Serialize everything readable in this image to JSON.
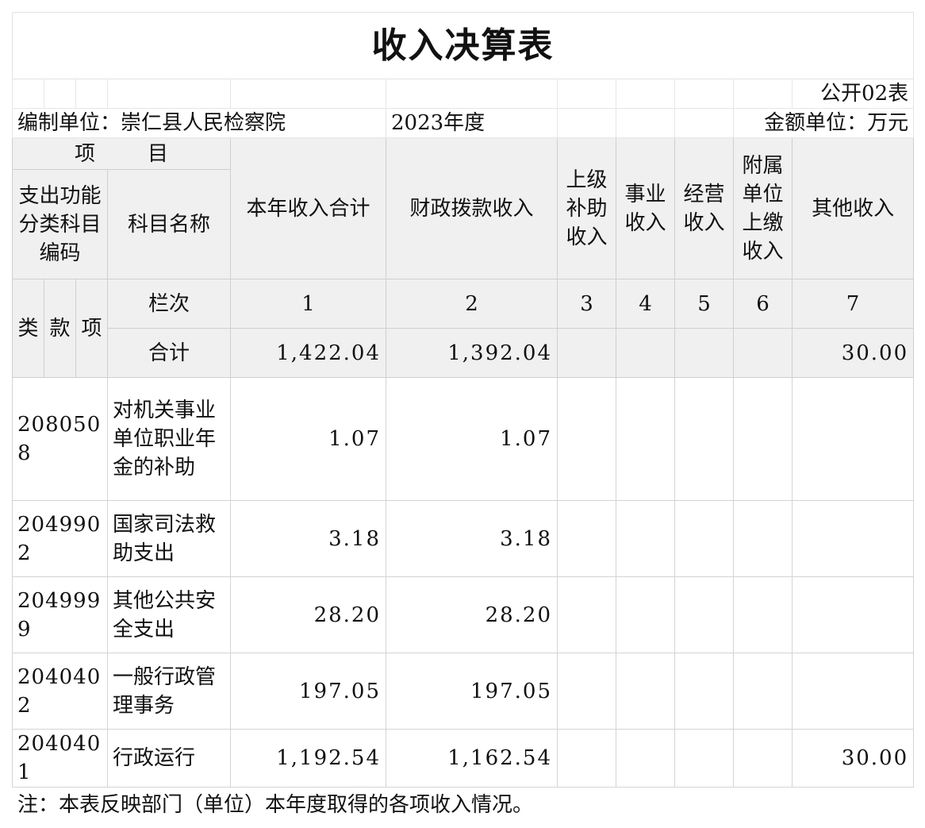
{
  "title": "收入决算表",
  "table_no": "公开02表",
  "unit_label": "编制单位：崇仁县人民检察院",
  "year": "2023年度",
  "amount_unit": "金额单位：万元",
  "headers": {
    "item": "项        目",
    "func_code": "支出功能分类科目编码",
    "subject_name": "科目名称",
    "col_total": "本年收入合计",
    "col_fiscal": "财政拨款收入",
    "col_superior": "上级补助收入",
    "col_business": "事业收入",
    "col_operating": "经营收入",
    "col_affiliated": "附属单位上缴收入",
    "col_other": "其他收入",
    "lei": "类",
    "kuan": "款",
    "xiang": "项",
    "row_index_label": "栏次",
    "col_numbers": [
      "1",
      "2",
      "3",
      "4",
      "5",
      "6",
      "7"
    ]
  },
  "total_row": {
    "label": "合计",
    "total": "1,422.04",
    "fiscal": "1,392.04",
    "other": "30.00"
  },
  "rows": [
    {
      "code": "2080508",
      "name": "对机关事业单位职业年金的补助",
      "total": "1.07",
      "fiscal": "1.07",
      "other": ""
    },
    {
      "code": "2049902",
      "name": "国家司法救助支出",
      "total": "3.18",
      "fiscal": "3.18",
      "other": ""
    },
    {
      "code": "2049999",
      "name": "其他公共安全支出",
      "total": "28.20",
      "fiscal": "28.20",
      "other": ""
    },
    {
      "code": "2040402",
      "name": "一般行政管理事务",
      "total": "197.05",
      "fiscal": "197.05",
      "other": ""
    },
    {
      "code": "2040401",
      "name": "行政运行",
      "total": "1,192.54",
      "fiscal": "1,162.54",
      "other": "30.00"
    }
  ],
  "note": "注：本表反映部门（单位）本年度取得的各项收入情况。"
}
